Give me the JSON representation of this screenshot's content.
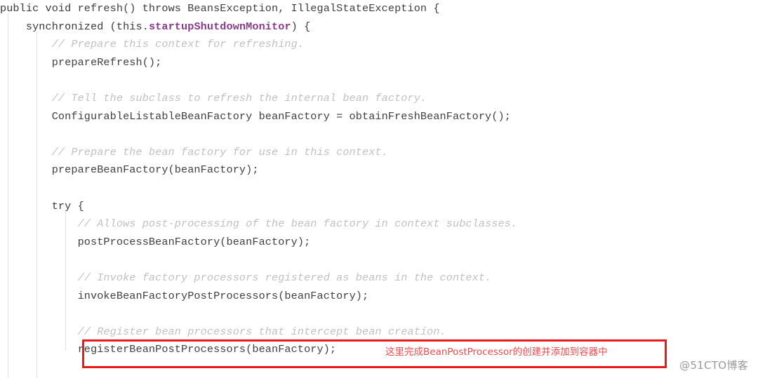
{
  "editor": {
    "language": "java",
    "background_color": "#ffffff",
    "indent_guide_color": "#e2e2e2",
    "colors": {
      "keyword": "#000080",
      "field": "#8b3a8b",
      "plain": "#3f3f3f",
      "comment": "#c0c0c0",
      "highlight_border": "#e81a1a",
      "annotation": "#f4494b",
      "watermark": "#9a9a9a"
    }
  },
  "code": {
    "lines": [
      {
        "indent": 0,
        "tokens": [
          {
            "type": "keyword",
            "text": "public void "
          },
          {
            "type": "plain",
            "text": "refresh() "
          },
          {
            "type": "keyword",
            "text": "throws "
          },
          {
            "type": "plain",
            "text": "BeansException, IllegalStateException {"
          }
        ]
      },
      {
        "indent": 1,
        "tokens": [
          {
            "type": "keyword",
            "text": "synchronized "
          },
          {
            "type": "keyword",
            "text": "(this."
          },
          {
            "type": "field",
            "text": "startupShutdownMonitor"
          },
          {
            "type": "keyword",
            "text": ") {"
          }
        ]
      },
      {
        "indent": 2,
        "tokens": [
          {
            "type": "comment",
            "text": "// Prepare this context for refreshing."
          }
        ]
      },
      {
        "indent": 2,
        "tokens": [
          {
            "type": "plain",
            "text": "prepareRefresh();"
          }
        ]
      },
      {
        "indent": 0,
        "tokens": []
      },
      {
        "indent": 2,
        "tokens": [
          {
            "type": "comment",
            "text": "// Tell the subclass to refresh the internal bean factory."
          }
        ]
      },
      {
        "indent": 2,
        "tokens": [
          {
            "type": "plain",
            "text": "ConfigurableListableBeanFactory beanFactory = obtainFreshBeanFactory();"
          }
        ]
      },
      {
        "indent": 0,
        "tokens": []
      },
      {
        "indent": 2,
        "tokens": [
          {
            "type": "comment",
            "text": "// Prepare the bean factory for use in this context."
          }
        ]
      },
      {
        "indent": 2,
        "tokens": [
          {
            "type": "plain",
            "text": "prepareBeanFactory(beanFactory);"
          }
        ]
      },
      {
        "indent": 0,
        "tokens": []
      },
      {
        "indent": 2,
        "tokens": [
          {
            "type": "keyword",
            "text": "try"
          },
          {
            "type": "plain",
            "text": " {"
          }
        ]
      },
      {
        "indent": 3,
        "tokens": [
          {
            "type": "comment",
            "text": "// Allows post-processing of the bean factory in context subclasses."
          }
        ]
      },
      {
        "indent": 3,
        "tokens": [
          {
            "type": "plain",
            "text": "postProcessBeanFactory(beanFactory);"
          }
        ]
      },
      {
        "indent": 0,
        "tokens": []
      },
      {
        "indent": 3,
        "tokens": [
          {
            "type": "comment",
            "text": "// Invoke factory processors registered as beans in the context."
          }
        ]
      },
      {
        "indent": 3,
        "tokens": [
          {
            "type": "plain",
            "text": "invokeBeanFactoryPostProcessors(beanFactory);"
          }
        ]
      },
      {
        "indent": 0,
        "tokens": []
      },
      {
        "indent": 3,
        "tokens": [
          {
            "type": "comment",
            "text": "// Register bean processors that intercept bean creation."
          }
        ]
      },
      {
        "indent": 3,
        "tokens": [
          {
            "type": "plain",
            "text": "registerBeanPostProcessors(beanFactory);"
          }
        ]
      }
    ]
  },
  "annotation": {
    "text": "这里完成BeanPostProcessor的创建并添加到容器中"
  },
  "highlight": {
    "label": "registerBeanPostProcessors highlight"
  },
  "watermark": {
    "text": "@51CTO博客"
  }
}
